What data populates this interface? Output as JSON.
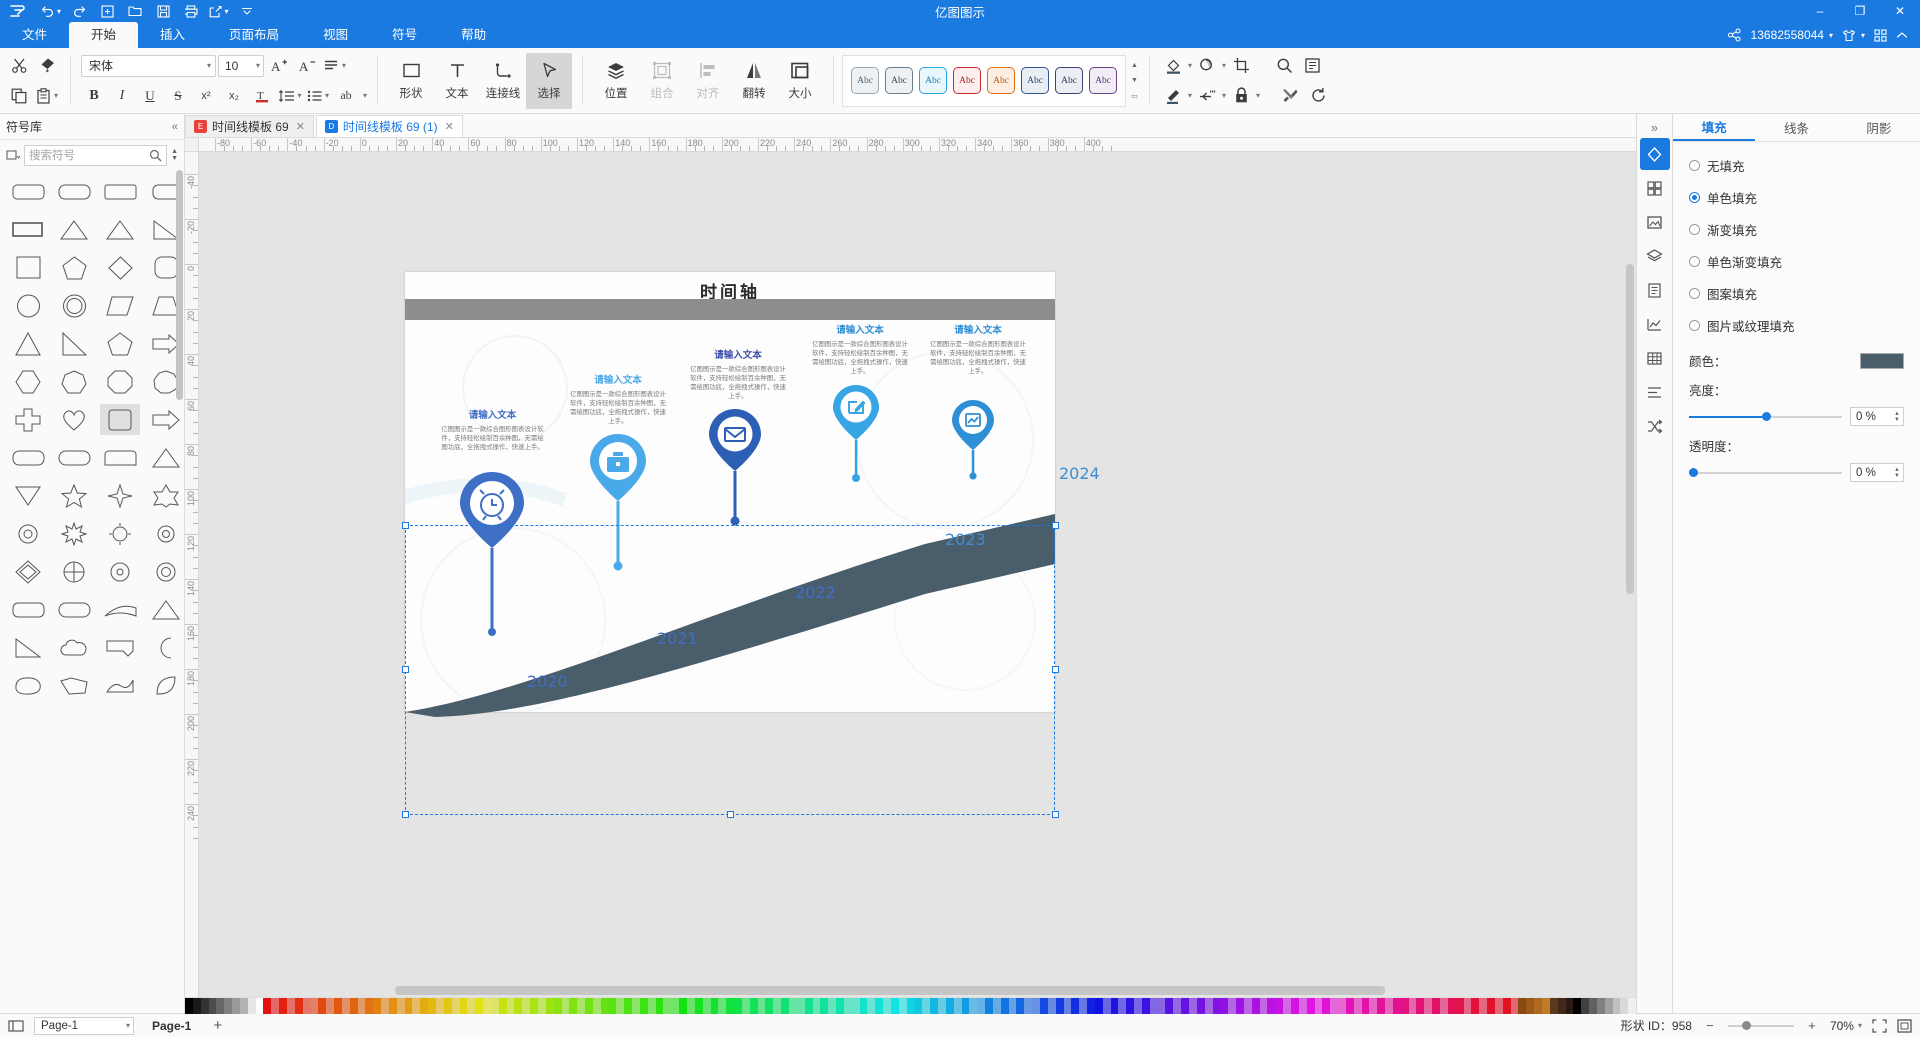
{
  "app": {
    "window_title": "亿图图示",
    "logo": "E"
  },
  "quick_access": [
    {
      "name": "undo-icon",
      "label": "撤销"
    },
    {
      "name": "redo-icon",
      "label": "重做"
    },
    {
      "name": "new-icon",
      "label": "新建"
    },
    {
      "name": "open-icon",
      "label": "打开"
    },
    {
      "name": "save-icon",
      "label": "保存"
    },
    {
      "name": "print-icon",
      "label": "打印"
    },
    {
      "name": "export-icon",
      "label": "导出"
    },
    {
      "name": "more-icon",
      "label": "更多"
    }
  ],
  "window_controls": {
    "minimize": "–",
    "maximize": "❐",
    "close": "✕"
  },
  "menu": {
    "items": [
      {
        "label": "文件",
        "active": false
      },
      {
        "label": "开始",
        "active": true
      },
      {
        "label": "插入",
        "active": false
      },
      {
        "label": "页面布局",
        "active": false
      },
      {
        "label": "视图",
        "active": false
      },
      {
        "label": "符号",
        "active": false
      },
      {
        "label": "帮助",
        "active": false
      }
    ],
    "account": "13682558044",
    "share_icon": "share-icon",
    "theme_icon": "shirt-icon",
    "apps_icon": "grid-apps-icon",
    "collapse_icon": "chevron-up-icon"
  },
  "ribbon": {
    "clipboard": {
      "cut": "剪切",
      "format_painter": "格式刷",
      "copy": "复制",
      "paste": "粘贴"
    },
    "font": {
      "family_value": "宋体",
      "size_value": "10",
      "grow": "增大字号",
      "shrink": "减小字号",
      "align": "对齐",
      "bold": "B",
      "italic": "I",
      "underline": "U",
      "strike": "S",
      "superscript": "x²",
      "subscript": "x₂",
      "text_color": "T",
      "line_spacing": "行距",
      "list": "列表",
      "case": "ab"
    },
    "tools": [
      {
        "label": "形状",
        "icon": "square-icon",
        "state": "normal"
      },
      {
        "label": "文本",
        "icon": "text-icon",
        "state": "normal"
      },
      {
        "label": "连接线",
        "icon": "connector-icon",
        "state": "normal"
      },
      {
        "label": "选择",
        "icon": "cursor-icon",
        "state": "selected"
      }
    ],
    "arrange": [
      {
        "label": "位置",
        "icon": "layers-icon",
        "state": "normal"
      },
      {
        "label": "组合",
        "icon": "group-icon",
        "state": "disabled"
      },
      {
        "label": "对齐",
        "icon": "align-icon",
        "state": "disabled"
      },
      {
        "label": "翻转",
        "icon": "flip-icon",
        "state": "normal"
      },
      {
        "label": "大小",
        "icon": "size-icon",
        "state": "normal"
      }
    ],
    "styles": {
      "label": "Abc",
      "swatches": [
        {
          "bg": "#eef1f4",
          "border": "#9aa7b4",
          "text": "#4a5d6b"
        },
        {
          "bg": "#eef1f4",
          "border": "#6b7c8c",
          "text": "#3c4a56"
        },
        {
          "bg": "#e8f6fd",
          "border": "#29a8e0",
          "text": "#1d7fad"
        },
        {
          "bg": "#fdeeee",
          "border": "#d0262e",
          "text": "#a81f26"
        },
        {
          "bg": "#fdeee4",
          "border": "#e2700f",
          "text": "#b8580b"
        },
        {
          "bg": "#e9eef5",
          "border": "#33548c",
          "text": "#2a4573"
        },
        {
          "bg": "#eceef4",
          "border": "#3b3f72",
          "text": "#30345e"
        },
        {
          "bg": "#f3eef6",
          "border": "#6b3f8c",
          "text": "#583375"
        }
      ]
    },
    "right_tools": [
      {
        "name": "fill-color-icon",
        "label": "填充颜色"
      },
      {
        "name": "shadow-icon",
        "label": "阴影"
      },
      {
        "name": "crop-icon",
        "label": "裁剪"
      },
      {
        "name": "line-color-icon",
        "label": "线条颜色"
      },
      {
        "name": "connector-style-icon",
        "label": "连接线样式"
      },
      {
        "name": "lock-icon",
        "label": "锁定"
      },
      {
        "name": "find-icon",
        "label": "查找"
      },
      {
        "name": "notes-icon",
        "label": "备注"
      },
      {
        "name": "tools-icon",
        "label": "工具"
      },
      {
        "name": "refresh-icon",
        "label": "刷新"
      }
    ]
  },
  "library": {
    "title": "符号库",
    "collapse_icon": "collapse-left-icon",
    "search_placeholder": "搜索符号",
    "search_icon": "search-icon",
    "filter_icon": "filter-icon",
    "selected_index": 23
  },
  "tabs": [
    {
      "label": "时间线模板 69",
      "active": false,
      "badge": "E"
    },
    {
      "label": "时间线模板 69 (1)",
      "active": true,
      "badge": "D"
    }
  ],
  "ruler": {
    "h_labels": [
      "-80",
      "-60",
      "-40",
      "-20",
      "0",
      "20",
      "40",
      "60",
      "80",
      "100",
      "120",
      "140",
      "160",
      "180",
      "200",
      "220",
      "240",
      "260",
      "280",
      "300",
      "320",
      "340",
      "360",
      "380",
      "400"
    ],
    "v_labels": [
      "-40",
      "-20",
      "0",
      "20",
      "40",
      "60",
      "80",
      "100",
      "120",
      "140",
      "160",
      "180",
      "200",
      "220",
      "240"
    ]
  },
  "canvas": {
    "page_title": "时间轴",
    "nodes": [
      {
        "title": "请输入文本",
        "desc": "亿图图示是一款综合图形图表设计软件，支持轻松绘制百余种图，无需绘图功底，全拖拽式操作，快速上手。",
        "icon": "alarm-clock-icon",
        "color": "#3f6fc4",
        "title_color": "#3f6fc4"
      },
      {
        "title": "请输入文本",
        "desc": "亿图图示是一款综合图形图表设计软件，支持轻松绘制百余种图，无需绘图功底，全拖拽式操作，快速上手。",
        "icon": "briefcase-icon",
        "color": "#4aa9e8",
        "title_color": "#4aa9e8"
      },
      {
        "title": "请输入文本",
        "desc": "亿图图示是一款综合图形图表设计软件，支持轻松绘制百余种图，无需绘图功底，全拖拽式操作，快速上手。",
        "icon": "mail-icon",
        "color": "#2c5fb5",
        "title_color": "#3b4ea8"
      },
      {
        "title": "请输入文本",
        "desc": "亿图图示是一款综合图形图表设计软件，支持轻松绘制百余种图，无需绘图功底，全拖拽式操作，快速上手。",
        "icon": "edit-icon",
        "color": "#37a5e4",
        "title_color": "#2f8fd6"
      },
      {
        "title": "请输入文本",
        "desc": "亿图图示是一款综合图形图表设计软件，支持轻松绘制百余种图，无需绘图功底，全拖拽式操作，快速上手。",
        "icon": "chart-icon",
        "color": "#2f8fd6",
        "title_color": "#2f8fd6"
      }
    ],
    "years": [
      {
        "label": "2020",
        "color": "#3f6fc4"
      },
      {
        "label": "2021",
        "color": "#3f6fc4"
      },
      {
        "label": "2022",
        "color": "#3f6fc4"
      },
      {
        "label": "2023",
        "color": "#3d8ed0"
      },
      {
        "label": "2024",
        "color": "#3d8ed0"
      }
    ],
    "road_color": "#4a5d6b",
    "band_color": "#8d8d8d"
  },
  "right_rail": {
    "expand_icon": "expand-right-icon",
    "items": [
      {
        "name": "fill-panel-icon",
        "active": true
      },
      {
        "name": "theme-panel-icon",
        "active": false
      },
      {
        "name": "image-panel-icon",
        "active": false
      },
      {
        "name": "layers-panel-icon",
        "active": false
      },
      {
        "name": "page-panel-icon",
        "active": false
      },
      {
        "name": "chart-panel-icon",
        "active": false
      },
      {
        "name": "table-panel-icon",
        "active": false
      },
      {
        "name": "list-panel-icon",
        "active": false
      },
      {
        "name": "shuffle-panel-icon",
        "active": false
      }
    ]
  },
  "right_panel": {
    "tabs": [
      {
        "label": "填充",
        "active": true
      },
      {
        "label": "线条",
        "active": false
      },
      {
        "label": "阴影",
        "active": false
      }
    ],
    "fill_options": [
      {
        "label": "无填充",
        "selected": false
      },
      {
        "label": "单色填充",
        "selected": true
      },
      {
        "label": "渐变填充",
        "selected": false
      },
      {
        "label": "单色渐变填充",
        "selected": false
      },
      {
        "label": "图案填充",
        "selected": false
      },
      {
        "label": "图片或纹理填充",
        "selected": false
      }
    ],
    "color_label": "颜色：",
    "color_value": "#4a5d6b",
    "brightness_label": "亮度：",
    "brightness_value": "0 %",
    "brightness_pct": 50,
    "opacity_label": "透明度：",
    "opacity_value": "0 %",
    "opacity_pct": 0
  },
  "status_bar": {
    "view_icon": "view-mode-icon",
    "page_select": "Page-1",
    "page_tab": "Page-1",
    "add_page": "+",
    "shape_id": "形状 ID：958",
    "zoom_out": "−",
    "zoom_in": "+",
    "zoom_value": "70%",
    "fit_icon": "fit-page-icon",
    "fullscreen_icon": "fullscreen-icon"
  }
}
